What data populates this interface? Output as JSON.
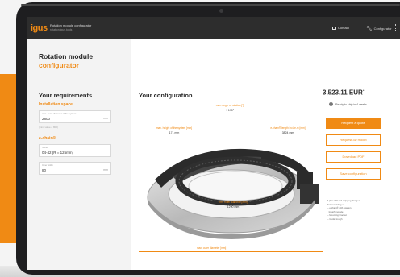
{
  "header": {
    "logo": "igus",
    "app_title": "Rotation module configurator",
    "app_subtitle": "rotation.igus.tools",
    "nav_contact": "Contact",
    "nav_configurator": "Configurator"
  },
  "left": {
    "title_line1": "Rotation module",
    "title_line2": "configurator",
    "requirements_title": "Your requirements",
    "installation_space": "Installation space",
    "field_diameter": {
      "label": "max. outer diameter of the system",
      "value": "2800",
      "unit": "mm"
    },
    "field_diameter_hint": "(min. value ≥ 800)",
    "echain_label": "e-chain®",
    "field_series": {
      "label": "Series",
      "value": "04-42 (R = 125mm)"
    },
    "field_width": {
      "label": "Inner width",
      "value": "80",
      "unit": "mm"
    }
  },
  "center": {
    "title": "Your configuration",
    "angle_label": "max. angle of rotation [°]",
    "angle_value": "+ 190°",
    "height_label": "max. height of the system [mm]",
    "height_value": "171 mm",
    "chain_label": "e-chain® length incl. e-rc [mm]",
    "chain_value": "3824 mm",
    "inner_diam_label": "min. inner diameter [mm]",
    "inner_diam_value": "1290 mm",
    "outer_diam_label": "max. outer diameter [mm]"
  },
  "right": {
    "price": "3,523.11 EUR",
    "price_mark": "*",
    "shipping": "Ready to ship in 4 weeks",
    "btn_quote": "Request a quote",
    "btn_3d": "Request 3D model",
    "btn_pdf": "Download PDF",
    "btn_save": "Save configuration",
    "note_vat": "* plus VAT and shipping charges",
    "note_consisting": "Set consisting of:",
    "note_items": [
      "e-chain® with rotation",
      "trough module",
      "Mounting bracket",
      "Guide trough"
    ]
  },
  "colors": {
    "accent": "#f08a14",
    "dark": "#2d2d2d"
  }
}
